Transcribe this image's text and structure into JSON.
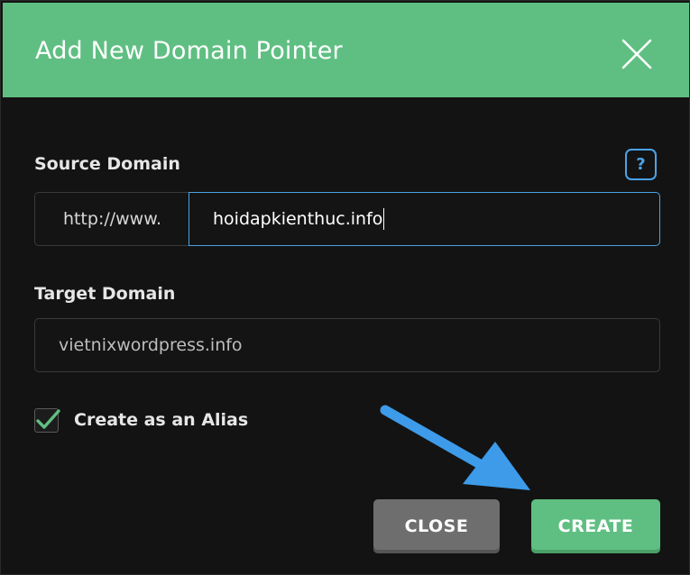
{
  "dialog": {
    "title": "Add New Domain Pointer"
  },
  "source_domain": {
    "label": "Source Domain",
    "help_glyph": "?",
    "prefix": "http://www.",
    "value": "hoidapkienthuc.info"
  },
  "target_domain": {
    "label": "Target Domain",
    "value": "vietnixwordpress.info"
  },
  "alias": {
    "label": "Create as an Alias",
    "checked": true
  },
  "buttons": {
    "close_label": "CLOSE",
    "create_label": "CREATE"
  },
  "colors": {
    "header": "#5fbf82",
    "accent_blue": "#4aa3e6",
    "close_button": "#6e6e6e",
    "create_button": "#5fbf82",
    "annotation_arrow": "#3d9be9"
  },
  "icons": {
    "close": "close-icon",
    "help": "question-mark-icon",
    "check": "check-icon",
    "annotation": "arrow-annotation-icon"
  }
}
